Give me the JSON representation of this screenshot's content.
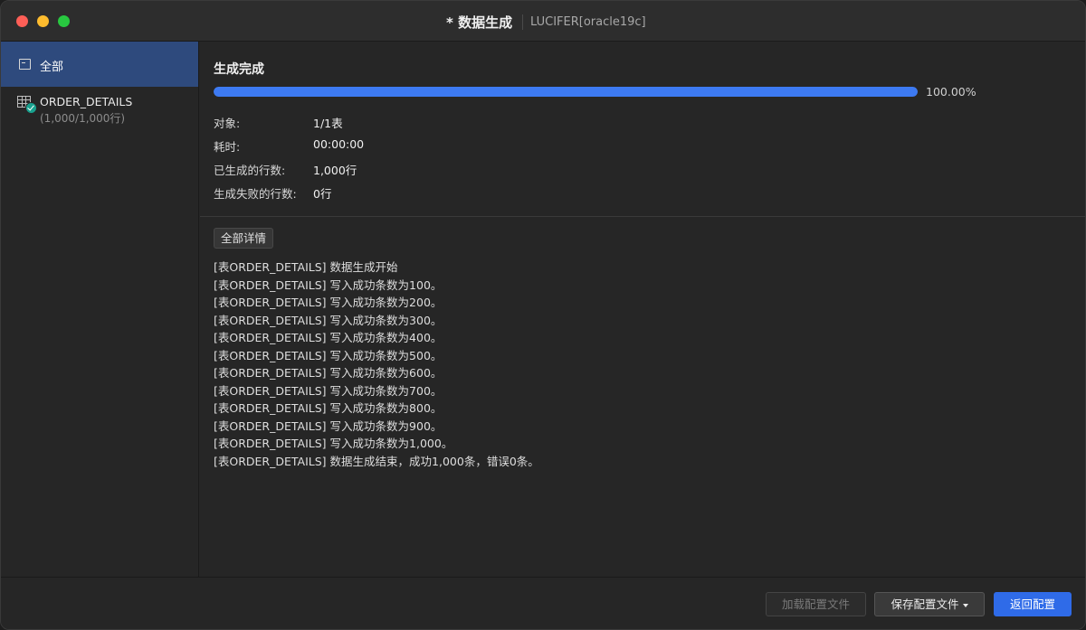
{
  "window": {
    "title": "* 数据生成",
    "subtitle": "LUCIFER[oracle19c]"
  },
  "sidebar": {
    "all_label": "全部",
    "table_name": "ORDER_DETAILS",
    "table_count": "(1,000/1,000行)"
  },
  "main": {
    "status_title": "生成完成",
    "progress_percent_text": "100.00%",
    "progress_fraction": 1.0,
    "stats": [
      {
        "label": "对象:",
        "value": "1/1表"
      },
      {
        "label": "耗时:",
        "value": "00:00:00"
      },
      {
        "label": "已生成的行数:",
        "value": "1,000行"
      },
      {
        "label": "生成失败的行数:",
        "value": "0行"
      }
    ],
    "details_button": "全部详情",
    "log": [
      "[表ORDER_DETAILS] 数据生成开始",
      "[表ORDER_DETAILS] 写入成功条数为100。",
      "[表ORDER_DETAILS] 写入成功条数为200。",
      "[表ORDER_DETAILS] 写入成功条数为300。",
      "[表ORDER_DETAILS] 写入成功条数为400。",
      "[表ORDER_DETAILS] 写入成功条数为500。",
      "[表ORDER_DETAILS] 写入成功条数为600。",
      "[表ORDER_DETAILS] 写入成功条数为700。",
      "[表ORDER_DETAILS] 写入成功条数为800。",
      "[表ORDER_DETAILS] 写入成功条数为900。",
      "[表ORDER_DETAILS] 写入成功条数为1,000。",
      "[表ORDER_DETAILS] 数据生成结束，成功1,000条，错误0条。"
    ]
  },
  "footer": {
    "load_config": "加载配置文件",
    "save_config": "保存配置文件",
    "back_to_config": "返回配置"
  },
  "colors": {
    "accent": "#2f6be8",
    "progress": "#3d7af2",
    "success": "#19a28f",
    "selected_sidebar": "#2e4a7d"
  }
}
